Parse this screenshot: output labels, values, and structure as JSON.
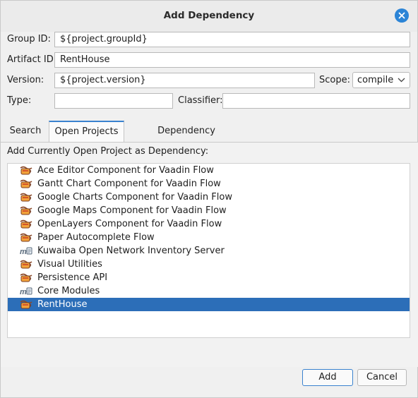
{
  "window": {
    "title": "Add Dependency"
  },
  "form": {
    "group_id_label": "Group ID:",
    "group_id_value": "${project.groupId}",
    "artifact_id_label": "Artifact ID:",
    "artifact_id_value": "RentHouse",
    "version_label": "Version:",
    "version_value": "${project.version}",
    "scope_label": "Scope:",
    "scope_value": "compile",
    "type_label": "Type:",
    "type_value": "",
    "classifier_label": "Classifier:",
    "classifier_value": ""
  },
  "tabs": [
    {
      "label": "Search"
    },
    {
      "label": "Open Projects",
      "active": true
    },
    {
      "label": "Dependency Management"
    }
  ],
  "open_projects": {
    "heading": "Add Currently Open Project as Dependency:",
    "items": [
      {
        "label": "Ace Editor Component for Vaadin Flow",
        "icon": "maven-project-icon"
      },
      {
        "label": "Gantt Chart Component for Vaadin Flow",
        "icon": "maven-project-icon"
      },
      {
        "label": "Google Charts Component for Vaadin Flow",
        "icon": "maven-project-icon"
      },
      {
        "label": "Google Maps Component for Vaadin Flow",
        "icon": "maven-project-icon"
      },
      {
        "label": "OpenLayers Component for Vaadin Flow",
        "icon": "maven-project-icon"
      },
      {
        "label": "Paper Autocomplete Flow",
        "icon": "maven-project-icon"
      },
      {
        "label": "Kuwaiba Open Network Inventory Server",
        "icon": "maven-pom-icon"
      },
      {
        "label": "Visual Utilities",
        "icon": "maven-project-icon"
      },
      {
        "label": "Persistence API",
        "icon": "maven-project-icon"
      },
      {
        "label": "Core Modules",
        "icon": "maven-pom-icon"
      },
      {
        "label": "RentHouse",
        "icon": "maven-project-icon",
        "selected": true
      }
    ]
  },
  "buttons": {
    "add": "Add",
    "cancel": "Cancel"
  },
  "colors": {
    "accent": "#2c6eb8",
    "close": "#2b84d6"
  }
}
